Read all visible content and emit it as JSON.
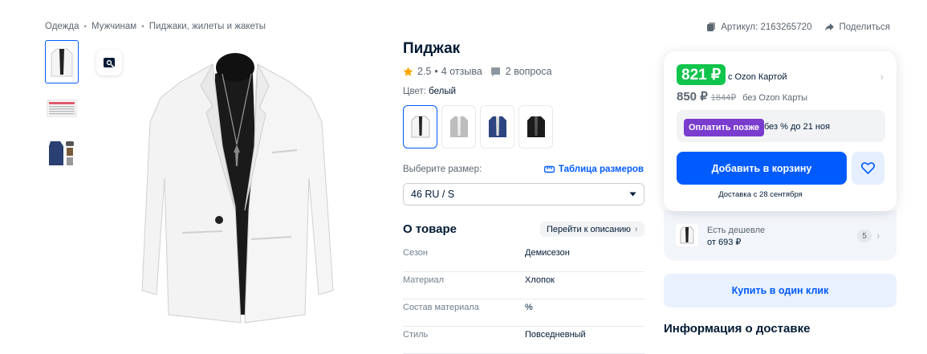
{
  "breadcrumb": [
    "Одежда",
    "Мужчинам",
    "Пиджаки, жилеты и жакеты"
  ],
  "breadcrumb_sep": "•",
  "topbar": {
    "article": "Артикул: 2163265720",
    "share": "Поделиться"
  },
  "product": {
    "title": "Пиджак",
    "rating": "2.5",
    "reviews": "4 отзыва",
    "questions": "2 вопроса",
    "color_label": "Цвет:",
    "color_value": "белый",
    "size_label": "Выберите размер:",
    "size_table": "Таблица размеров",
    "size_selected": "46 RU / S"
  },
  "about": {
    "heading": "О товаре",
    "goto_desc": "Перейти к описанию",
    "specs": [
      {
        "k": "Сезон",
        "v": "Демисезон"
      },
      {
        "k": "Материал",
        "v": "Хлопок"
      },
      {
        "k": "Состав материала",
        "v": "%"
      },
      {
        "k": "Стиль",
        "v": "Повседневный"
      }
    ]
  },
  "buy": {
    "ozon_price": "821 ₽",
    "ozon_card": "с Ozon Картой",
    "price": "850 ₽",
    "old_price": "1844₽",
    "without": "без Ozon Карты",
    "pay_later_btn": "Оплатить позже",
    "pay_later_txt": "без % до 21 ноя",
    "add_to_cart": "Добавить в корзину",
    "delivery": "Доставка с 28 сентября"
  },
  "cheaper": {
    "label": "Есть дешевле",
    "price": "от 693 ₽",
    "count": "5"
  },
  "one_click": "Купить в один клик",
  "delivery_info": "Информация о доставке",
  "colors": {
    "accent": "#005bff",
    "green": "#10c44c",
    "purple": "#7a3ccf"
  }
}
